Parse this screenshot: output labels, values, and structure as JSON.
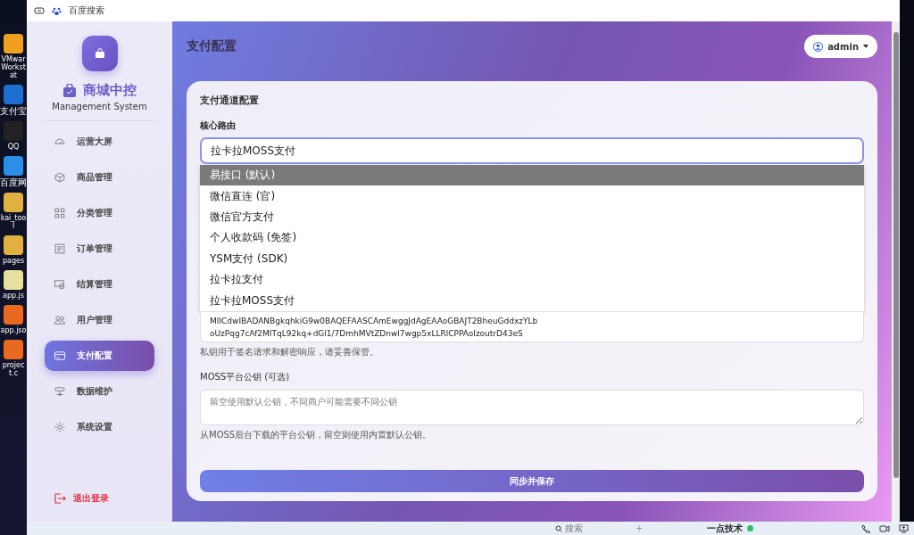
{
  "desktop": {
    "icons": [
      {
        "label": "VMwar Workstat",
        "color": "#f0a020"
      },
      {
        "label": "支付宝",
        "color": "#1d6fd1"
      },
      {
        "label": "QQ",
        "color": "#222222"
      },
      {
        "label": "百度网",
        "color": "#2b8fe8"
      },
      {
        "label": "kai_tool",
        "color": "#e0b040"
      },
      {
        "label": "pages",
        "color": "#e0b040"
      },
      {
        "label": "app.js",
        "color": "#e8e0a0"
      },
      {
        "label": "app.jso",
        "color": "#e86a20"
      },
      {
        "label": "project.c",
        "color": "#e86a20"
      }
    ]
  },
  "browser": {
    "tab_title": "百度搜索"
  },
  "sidebar": {
    "brand": "商城中控",
    "subtitle": "Management System",
    "items": [
      {
        "label": "运营大屏",
        "selected": false
      },
      {
        "label": "商品管理",
        "selected": false
      },
      {
        "label": "分类管理",
        "selected": false
      },
      {
        "label": "订单管理",
        "selected": false
      },
      {
        "label": "结算管理",
        "selected": false
      },
      {
        "label": "用户管理",
        "selected": false
      },
      {
        "label": "支付配置",
        "selected": true
      },
      {
        "label": "数据维护",
        "selected": false
      },
      {
        "label": "系统设置",
        "selected": false
      }
    ],
    "logout": "退出登录"
  },
  "header": {
    "title": "支付配置",
    "user": "admin"
  },
  "card": {
    "title": "支付通道配置",
    "route_label": "核心路由",
    "route_value": "拉卡拉MOSS支付",
    "options": [
      {
        "label": "易接口 (默认)",
        "selected": true
      },
      {
        "label": "微信直连 (官)",
        "selected": false
      },
      {
        "label": "微信官方支付",
        "selected": false
      },
      {
        "label": "个人收款码 (免签)",
        "selected": false
      },
      {
        "label": "YSM支付 (SDK)",
        "selected": false
      },
      {
        "label": "拉卡拉支付",
        "selected": false
      },
      {
        "label": "拉卡拉MOSS支付",
        "selected": false
      }
    ],
    "private_key_lines": [
      "MIICdwIBADANBgkqhkiG9w0BAQEFAASCAmEwggJdAgEAAoGBAJT2BheuGddxzYLb",
      "oUzPqg7cAf2MITqL92kq+dGl1/7DmhMVtZDnwl7wgp5xLLRlCPPAoIzoutrD43eS"
    ],
    "private_key_hint": "私钥用于签名请求和解密响应，请妥善保管。",
    "public_key_label": "MOSS平台公钥 (可选)",
    "public_key_placeholder": "留空使用默认公钥，不同商户可能需要不同公钥",
    "public_key_hint": "从MOSS后台下载的平台公钥，留空则使用内置默认公钥。",
    "save_button": "同步并保存"
  },
  "chat_bar": {
    "search": "搜索",
    "add": "+",
    "contact": "一点技术",
    "online": true
  }
}
